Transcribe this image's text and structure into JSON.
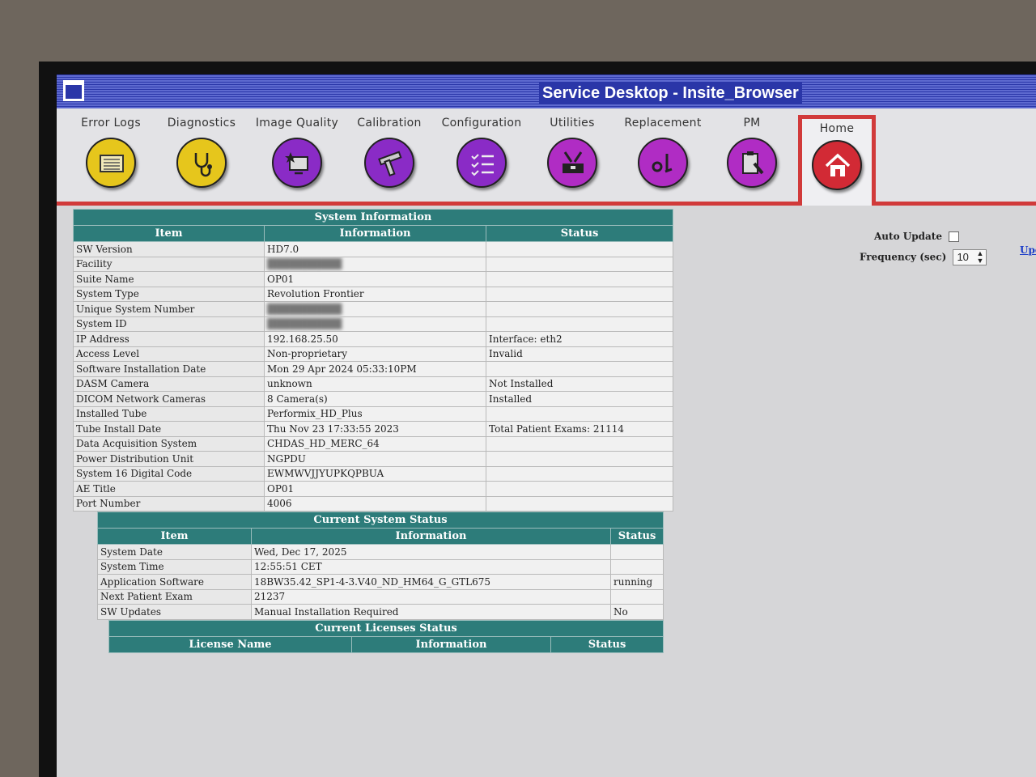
{
  "window": {
    "title": "Service Desktop - Insite_Browser"
  },
  "toolbar": {
    "items": [
      {
        "label": "Error Logs",
        "icon": "log-icon",
        "color": "#e6c61c"
      },
      {
        "label": "Diagnostics",
        "icon": "stethoscope-icon",
        "color": "#e6c61c"
      },
      {
        "label": "Image Quality",
        "icon": "monitor-star-icon",
        "color": "#8a2bc6"
      },
      {
        "label": "Calibration",
        "icon": "caliper-icon",
        "color": "#8a2bc6"
      },
      {
        "label": "Configuration",
        "icon": "checklist-icon",
        "color": "#8a2bc6"
      },
      {
        "label": "Utilities",
        "icon": "toolbox-icon",
        "color": "#b02cc4"
      },
      {
        "label": "Replacement",
        "icon": "wrench-icon",
        "color": "#b02cc4"
      },
      {
        "label": "PM",
        "icon": "clipboard-wrench-icon",
        "color": "#b02cc4"
      },
      {
        "label": "Home",
        "icon": "home-icon",
        "color": "#d22a35"
      }
    ]
  },
  "system_info": {
    "title": "System Information",
    "headers": [
      "Item",
      "Information",
      "Status"
    ],
    "rows": [
      {
        "item": "SW Version",
        "info": "HD7.0",
        "status": ""
      },
      {
        "item": "Facility",
        "info": "",
        "status": ""
      },
      {
        "item": "Suite Name",
        "info": "OP01",
        "status": ""
      },
      {
        "item": "System Type",
        "info": "Revolution Frontier",
        "status": ""
      },
      {
        "item": "Unique System Number",
        "info": "",
        "status": ""
      },
      {
        "item": "System ID",
        "info": "",
        "status": ""
      },
      {
        "item": "IP Address",
        "info": "192.168.25.50",
        "status": "Interface: eth2"
      },
      {
        "item": "Access Level",
        "info": "Non-proprietary",
        "status": "Invalid"
      },
      {
        "item": "Software Installation Date",
        "info": "Mon 29 Apr 2024 05:33:10PM",
        "status": ""
      },
      {
        "item": "DASM Camera",
        "info": "unknown",
        "status": "Not Installed"
      },
      {
        "item": "DICOM Network Cameras",
        "info": "8 Camera(s)",
        "status": "Installed"
      },
      {
        "item": "Installed Tube",
        "info": "Performix_HD_Plus",
        "status": ""
      },
      {
        "item": "Tube Install Date",
        "info": "Thu Nov 23 17:33:55 2023",
        "status": "Total Patient Exams: 21114"
      },
      {
        "item": "Data Acquisition System",
        "info": "CHDAS_HD_MERC_64",
        "status": ""
      },
      {
        "item": "Power Distribution Unit",
        "info": "NGPDU",
        "status": ""
      },
      {
        "item": "System 16 Digital Code",
        "info": "EWMWVJJYUPKQPBUA",
        "status": ""
      },
      {
        "item": "AE Title",
        "info": "OP01",
        "status": ""
      },
      {
        "item": "Port Number",
        "info": "4006",
        "status": ""
      }
    ]
  },
  "current_status": {
    "title": "Current System Status",
    "headers": [
      "Item",
      "Information",
      "Status"
    ],
    "rows": [
      {
        "item": "System Date",
        "info": "Wed, Dec 17, 2025",
        "status": ""
      },
      {
        "item": "System Time",
        "info": "12:55:51 CET",
        "status": ""
      },
      {
        "item": "Application Software",
        "info": "18BW35.42_SP1-4-3.V40_ND_HM64_G_GTL675",
        "status": "running"
      },
      {
        "item": "Next Patient Exam",
        "info": "21237",
        "status": ""
      },
      {
        "item": "SW Updates",
        "info": "Manual Installation Required",
        "status": "No"
      }
    ]
  },
  "licenses": {
    "title": "Current Licenses Status",
    "headers": [
      "License Name",
      "Information",
      "Status"
    ]
  },
  "controls": {
    "auto_update_label": "Auto Update",
    "frequency_label": "Frequency (sec)",
    "frequency_value": "10",
    "update_link": "Upd"
  }
}
